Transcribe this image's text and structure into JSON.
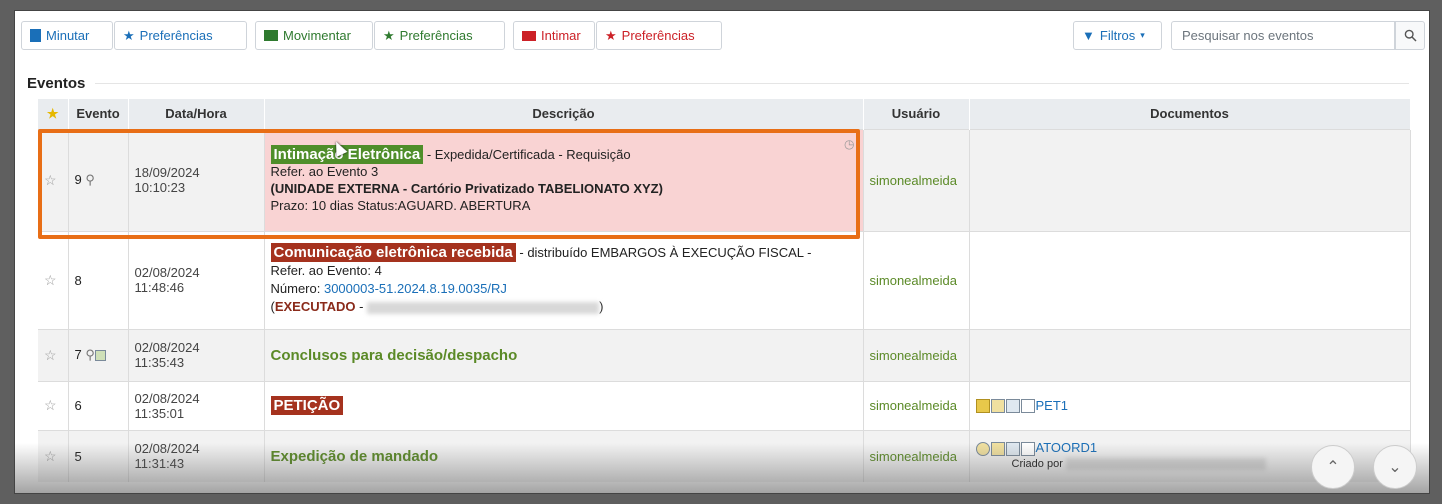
{
  "toolbar": {
    "minutar": "Minutar",
    "pref1": "Preferências",
    "movimentar": "Movimentar",
    "pref2": "Preferências",
    "intimar": "Intimar",
    "pref3": "Preferências",
    "filtros": "Filtros",
    "search_placeholder": "Pesquisar nos eventos"
  },
  "section_title": "Eventos",
  "columns": {
    "evento": "Evento",
    "data": "Data/Hora",
    "descricao": "Descrição",
    "usuario": "Usuário",
    "documentos": "Documentos"
  },
  "rows": [
    {
      "num": "9",
      "date": "18/09/2024",
      "time": "10:10:23",
      "tag": "Intimação Eletrônica",
      "rest": " - Expedida/Certificada - Requisição",
      "line2": "Refer. ao Evento 3",
      "line3": "(UNIDADE EXTERNA - Cartório Privatizado TABELIONATO XYZ)",
      "line4": "Prazo: 10 dias Status:AGUARD. ABERTURA",
      "user": "simonealmeida"
    },
    {
      "num": "8",
      "date": "02/08/2024",
      "time": "11:48:46",
      "tag": "Comunicação eletrônica recebida",
      "rest": " - distribuído EMBARGOS À EXECUÇÃO FISCAL -",
      "line2": "Refer. ao Evento: 4",
      "line3_label": "Número: ",
      "line3_link": "3000003-51.2024.8.19.0035/RJ",
      "line4_open": "(",
      "line4_bold": "EXECUTADO",
      "line4_rest": " - ",
      "line4_close": ")",
      "user": "simonealmeida"
    },
    {
      "num": "7",
      "date": "02/08/2024",
      "time": "11:35:43",
      "title": "Conclusos para decisão/despacho",
      "user": "simonealmeida"
    },
    {
      "num": "6",
      "date": "02/08/2024",
      "time": "11:35:01",
      "tag": "PETIÇÃO",
      "user": "simonealmeida",
      "doc": "PET1"
    },
    {
      "num": "5",
      "date": "02/08/2024",
      "time": "11:31:43",
      "title": "Expedição de mandado",
      "user": "simonealmeida",
      "doc": "ATOORD1",
      "doc_sub": "Criado por"
    }
  ]
}
